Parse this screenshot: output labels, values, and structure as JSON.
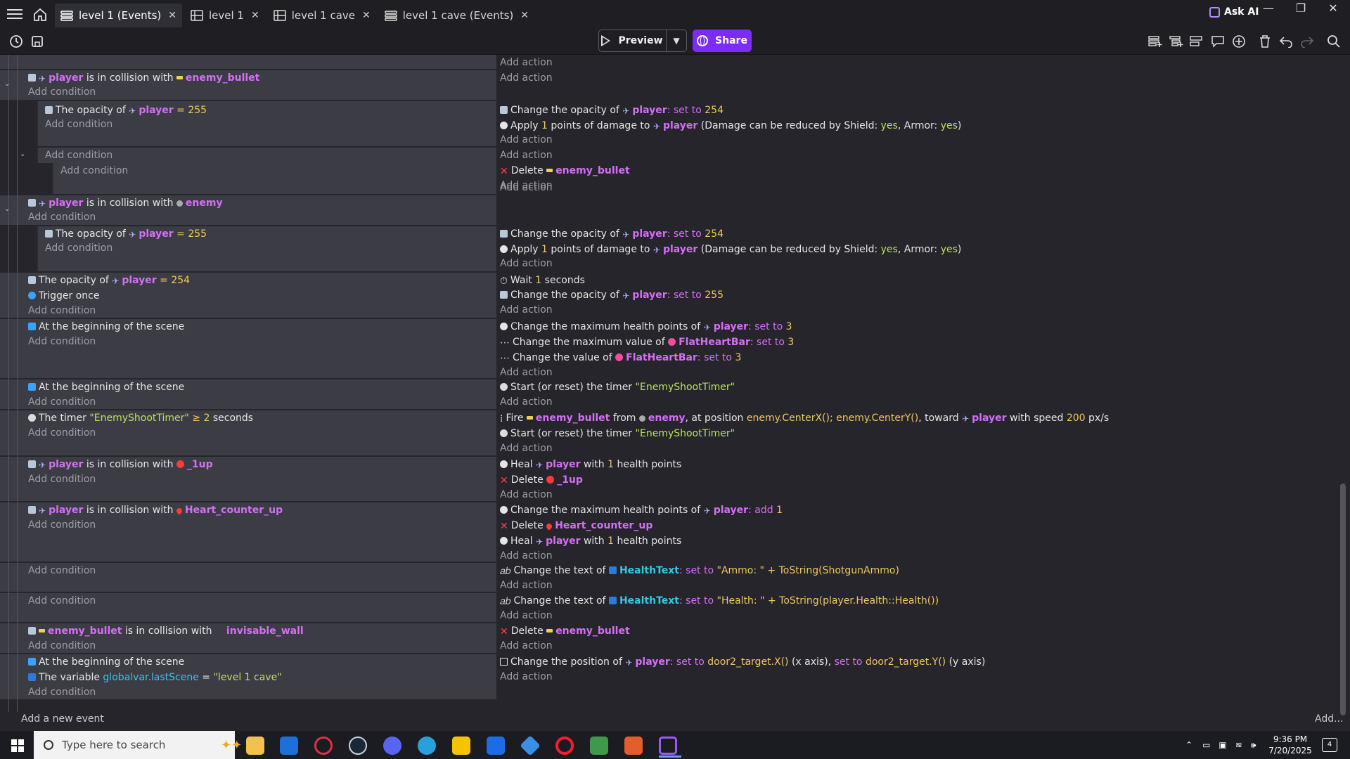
{
  "tabs": [
    {
      "label": "level 1 (Events)",
      "icon": "events-icon",
      "active": true
    },
    {
      "label": "level 1",
      "icon": "scene-icon",
      "active": false
    },
    {
      "label": "level 1 cave",
      "icon": "scene-icon",
      "active": false
    },
    {
      "label": "level 1 cave (Events)",
      "icon": "events-icon",
      "active": false
    }
  ],
  "ask_ai_label": "Ask AI",
  "toolbar": {
    "preview_label": "Preview",
    "share_label": "Share"
  },
  "add_condition": "Add condition",
  "add_action": "Add action",
  "events": {
    "e1": {
      "cond": [
        "player",
        "is in collision with",
        "enemy_bullet"
      ],
      "sub_cond": [
        "The opacity of",
        "player",
        "= 255"
      ],
      "a1": [
        "Change the opacity of",
        "player",
        ": set to",
        "254"
      ],
      "a2": [
        "Apply",
        "1",
        "points of damage to",
        "player",
        "(Damage can be reduced by Shield:",
        "yes",
        ", Armor:",
        "yes",
        ")"
      ],
      "a3": [
        "Delete",
        "enemy_bullet"
      ]
    },
    "e2": {
      "cond": [
        "player",
        "is in collision with",
        "enemy"
      ],
      "sub_cond": [
        "The opacity of",
        "player",
        "= 255"
      ],
      "a1": [
        "Change the opacity of",
        "player",
        ": set to",
        "254"
      ],
      "a2": [
        "Apply",
        "1",
        "points of damage to",
        "player",
        "(Damage can be reduced by Shield:",
        "yes",
        ", Armor:",
        "yes",
        ")"
      ]
    },
    "e3": {
      "c1": [
        "The opacity of",
        "player",
        "= 254"
      ],
      "c2": "Trigger once",
      "a1": [
        "Wait",
        "1",
        "seconds"
      ],
      "a2": [
        "Change the opacity of",
        "player",
        ": set to",
        "255"
      ]
    },
    "e4": {
      "c1": "At the beginning of the scene",
      "a1": [
        "Change the maximum health points of",
        "player",
        ": set to",
        "3"
      ],
      "a2": [
        "Change the maximum value of",
        "FlatHeartBar",
        ": set to",
        "3"
      ],
      "a3": [
        "Change the value of",
        "FlatHeartBar",
        ": set to",
        "3"
      ]
    },
    "e5": {
      "c1": "At the beginning of the scene",
      "a1": [
        "Start (or reset) the timer",
        "\"EnemyShootTimer\""
      ]
    },
    "e6": {
      "c1": [
        "The timer",
        "\"EnemyShootTimer\"",
        "≥",
        "2",
        "seconds"
      ],
      "a1": [
        "Fire",
        "enemy_bullet",
        "from",
        "enemy",
        ", at position",
        "enemy.CenterX(); enemy.CenterY()",
        ", toward",
        "player",
        "with speed",
        "200",
        "px/s"
      ],
      "a2": [
        "Start (or reset) the timer",
        "\"EnemyShootTimer\""
      ]
    },
    "e7": {
      "cond": [
        "player",
        "is in collision with",
        "_1up"
      ],
      "a1": [
        "Heal",
        "player",
        "with",
        "1",
        "health points"
      ],
      "a2": [
        "Delete",
        "_1up"
      ]
    },
    "e8": {
      "cond": [
        "player",
        "is in collision with",
        "Heart_counter_up"
      ],
      "a1": [
        "Change the maximum health points of",
        "player",
        ": add",
        "1"
      ],
      "a2": [
        "Delete",
        "Heart_counter_up"
      ],
      "a3": [
        "Heal",
        "player",
        "with",
        "1",
        "health points"
      ]
    },
    "e9": {
      "a1": [
        "Change the text of",
        "HealthText",
        ": set to",
        "\"Ammo: \" + ToString(ShotgunAmmo)"
      ]
    },
    "e10": {
      "a1": [
        "Change the text of",
        "HealthText",
        ": set to",
        "\"Health: \" + ToString(player.Health::Health())"
      ]
    },
    "e11": {
      "cond": [
        "enemy_bullet",
        "is in collision with",
        "invisable_wall"
      ],
      "a1": [
        "Delete",
        "enemy_bullet"
      ]
    },
    "e12": {
      "c1": "At the beginning of the scene",
      "c2": [
        "The variable",
        "globalvar.lastScene",
        "=",
        "\"level 1 cave\""
      ],
      "a1": [
        "Change the position of",
        "player",
        ": set to",
        "door2_target.X()",
        "(x axis),",
        "set to",
        "door2_target.Y()",
        "(y axis)"
      ]
    }
  },
  "add_new_event": "Add a new event",
  "add_more": "Add...",
  "taskbar": {
    "search_placeholder": "Type here to search",
    "time": "9:36 PM",
    "date": "7/20/2025",
    "notifications": "4"
  },
  "colors": {
    "accent": "#7b2cf5",
    "object": "#d46ff5",
    "value": "#f0c75e",
    "string": "#bde05c",
    "panel": "#3c3c45",
    "background": "#25252b"
  }
}
